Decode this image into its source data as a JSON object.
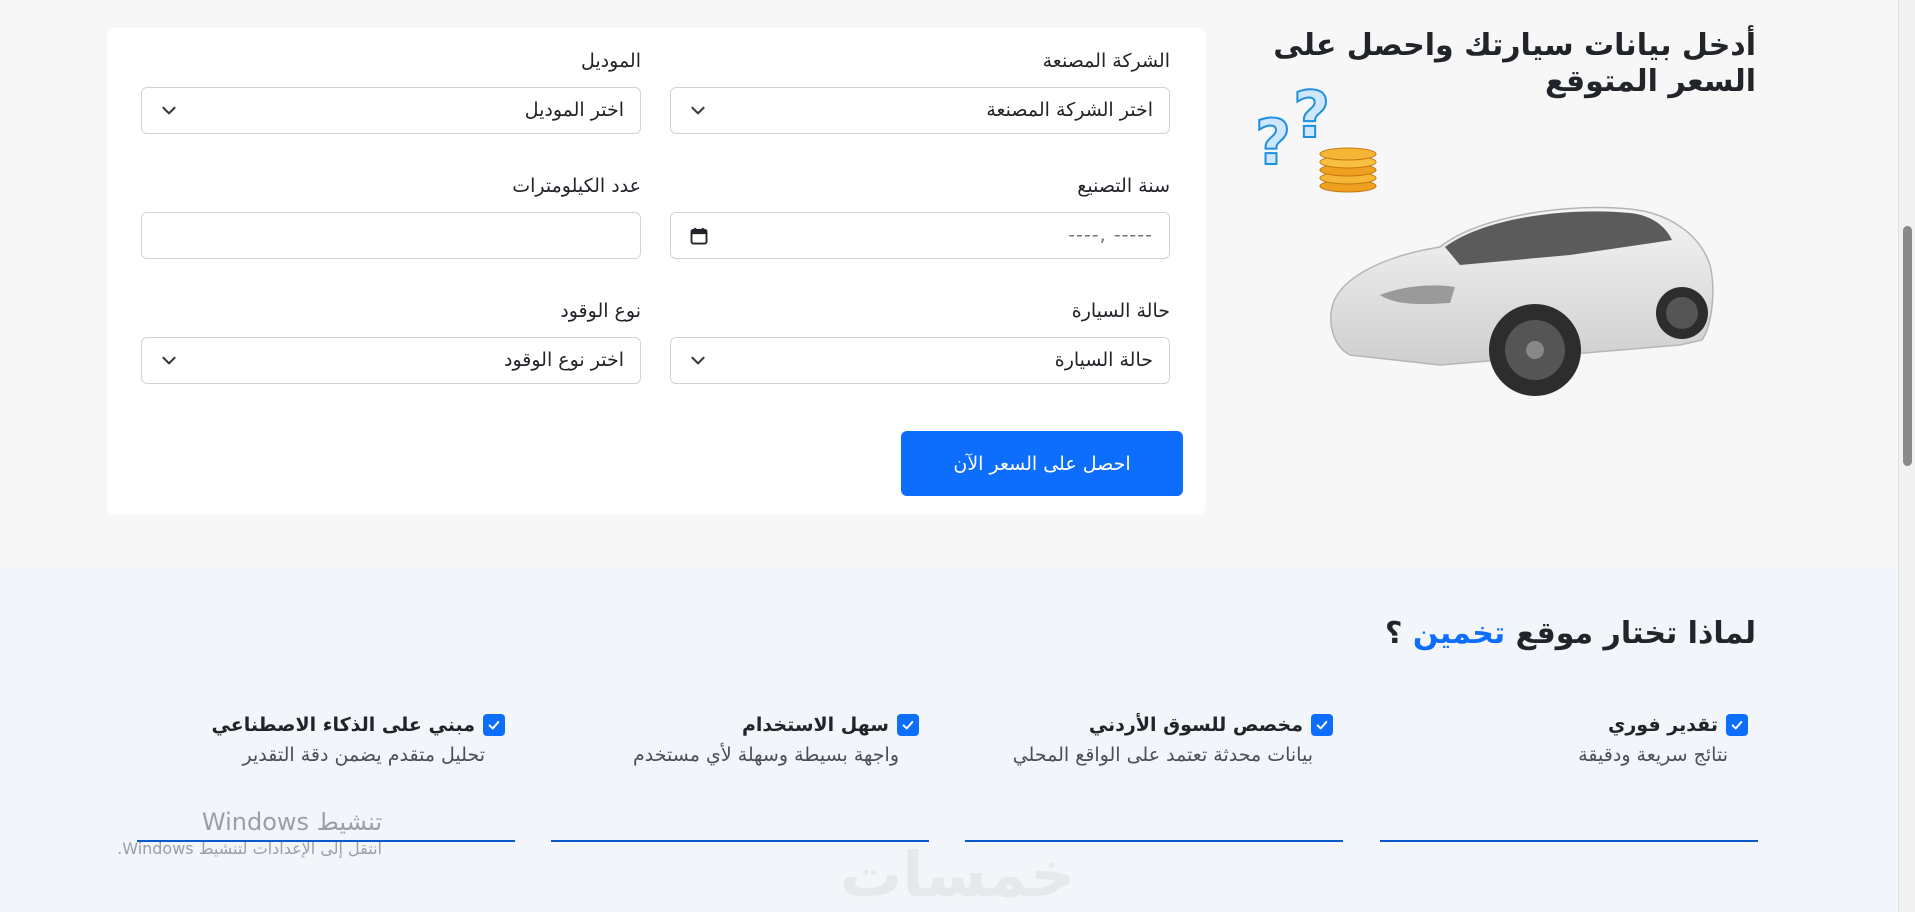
{
  "hero": {
    "title": "أدخل بيانات سيارتك واحصل على السعر المتوقع"
  },
  "form": {
    "manufacturer": {
      "label": "الشركة المصنعة",
      "value": "اختر الشركة المصنعة"
    },
    "model": {
      "label": "الموديل",
      "value": "اختر الموديل"
    },
    "year": {
      "label": "سنة التصنيع",
      "value": "----- ,----"
    },
    "mileage": {
      "label": "عدد الكيلومترات",
      "value": ""
    },
    "condition": {
      "label": "حالة السيارة",
      "value": "حالة السيارة"
    },
    "fuel": {
      "label": "نوع الوقود",
      "value": "اختر نوع الوقود"
    },
    "submit_label": "احصل على السعر الآن"
  },
  "why": {
    "title_prefix": "لماذا تختار موقع",
    "title_accent": "تخمين",
    "title_suffix": "؟",
    "features": [
      {
        "title": "تقدير فوري",
        "desc": "نتائج سريعة ودقيقة"
      },
      {
        "title": "مخصص للسوق الأردني",
        "desc": "بيانات محدثة تعتمد على الواقع المحلي"
      },
      {
        "title": "سهل الاستخدام",
        "desc": "واجهة بسيطة وسهلة لأي مستخدم"
      },
      {
        "title": "مبني على الذكاء الاصطناعي",
        "desc": "تحليل متقدم يضمن دقة التقدير"
      }
    ]
  },
  "watermarks": {
    "windows_title": "تنشيط Windows",
    "windows_sub": "انتقل إلى الإعدادات لتنشيط Windows.",
    "logo": "خمسات"
  },
  "colors": {
    "accent": "#0d6efd",
    "page_bg": "#f7f7f7",
    "section_bg": "#f2f5f9"
  }
}
